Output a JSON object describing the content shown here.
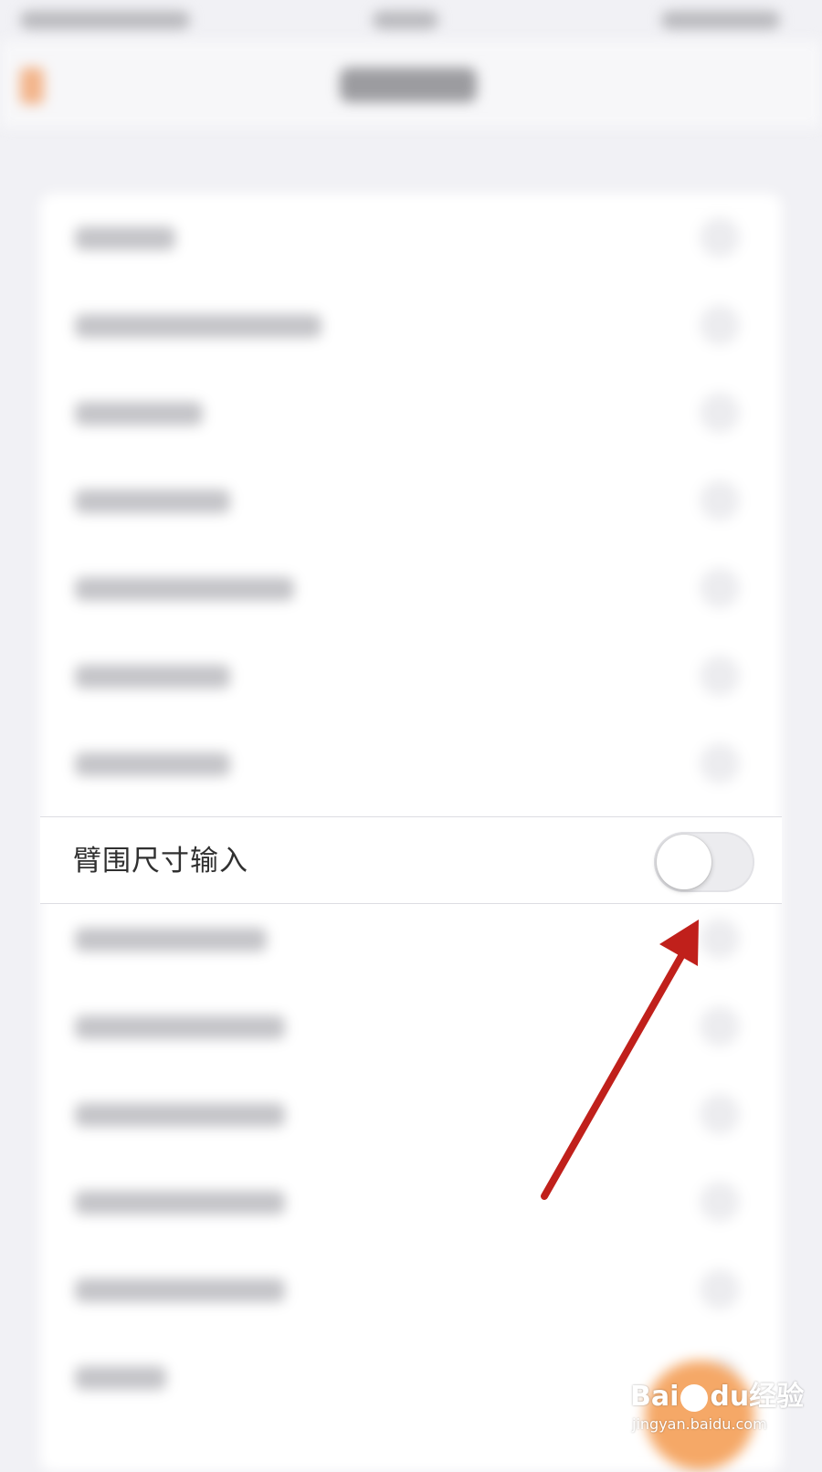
{
  "focus_row": {
    "label": "臂围尺寸输入",
    "toggle_on": false
  },
  "watermark": {
    "brand_left": "Bai",
    "brand_right": "du",
    "brand_cn": "经验",
    "url": "jingyan.baidu.com"
  },
  "colors": {
    "accent": "#f5a867",
    "arrow": "#c0201b",
    "toggle_off": "#ececef"
  },
  "icons": {
    "back": "chevron-left-icon",
    "annotation": "arrow-icon",
    "watermark_logo": "paw-icon"
  }
}
